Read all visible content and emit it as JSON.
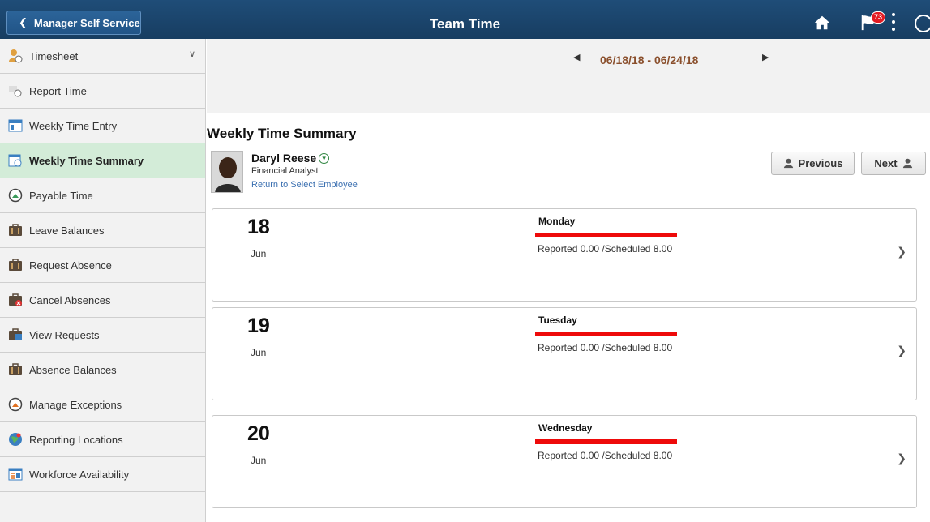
{
  "header": {
    "back_label": "Manager Self Service",
    "title": "Team Time",
    "notification_count": "73"
  },
  "sidebar": {
    "items": [
      {
        "label": "Timesheet",
        "icon": "timesheet-icon"
      },
      {
        "label": "Report Time",
        "icon": "report-time-icon"
      },
      {
        "label": "Weekly Time Entry",
        "icon": "weekly-time-entry-icon"
      },
      {
        "label": "Weekly Time Summary",
        "icon": "weekly-summary-icon"
      },
      {
        "label": "Payable Time",
        "icon": "payable-time-icon"
      },
      {
        "label": "Leave Balances",
        "icon": "briefcase-icon"
      },
      {
        "label": "Request Absence",
        "icon": "briefcase-icon"
      },
      {
        "label": "Cancel Absences",
        "icon": "briefcase-cancel-icon"
      },
      {
        "label": "View Requests",
        "icon": "briefcase-view-icon"
      },
      {
        "label": "Absence Balances",
        "icon": "briefcase-icon"
      },
      {
        "label": "Manage Exceptions",
        "icon": "exceptions-icon"
      },
      {
        "label": "Reporting Locations",
        "icon": "globe-icon"
      },
      {
        "label": "Workforce Availability",
        "icon": "availability-icon"
      }
    ]
  },
  "main": {
    "date_range": "06/18/18 - 06/24/18",
    "section_title": "Weekly Time Summary",
    "employee": {
      "name": "Daryl Reese",
      "title": "Financial Analyst",
      "link": "Return to Select Employee"
    },
    "prev_label": "Previous",
    "next_label": "Next",
    "days": [
      {
        "num": "18",
        "month": "Jun",
        "name": "Monday",
        "reported": "Reported 0.00 /Scheduled 8.00"
      },
      {
        "num": "19",
        "month": "Jun",
        "name": "Tuesday",
        "reported": "Reported 0.00 /Scheduled 8.00"
      },
      {
        "num": "20",
        "month": "Jun",
        "name": "Wednesday",
        "reported": "Reported 0.00 /Scheduled 8.00"
      }
    ]
  },
  "colors": {
    "header": "#1f4d78",
    "active_item": "#d3ecd8",
    "date_range": "#8a4f2c",
    "status_bar": "#ee0a0a"
  }
}
